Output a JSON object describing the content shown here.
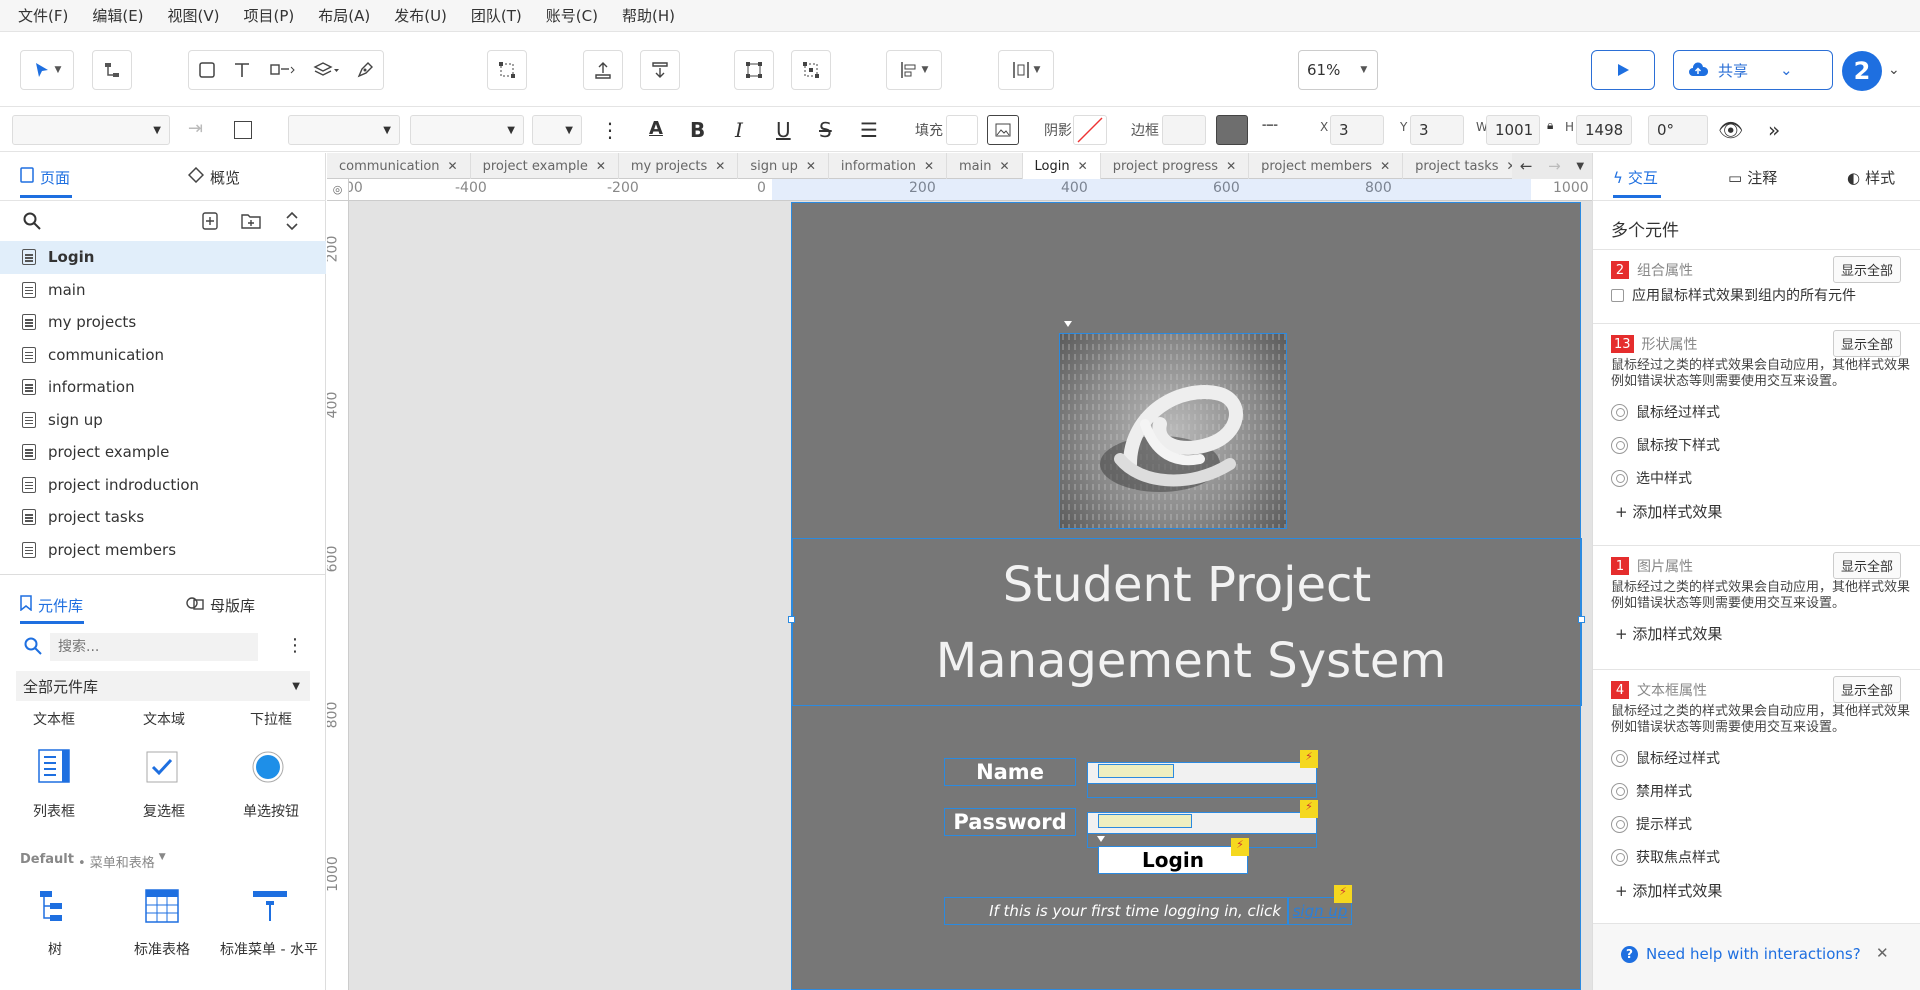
{
  "menubar": [
    "文件(F)",
    "编辑(E)",
    "视图(V)",
    "项目(P)",
    "布局(A)",
    "发布(U)",
    "团队(T)",
    "账号(C)",
    "帮助(H)"
  ],
  "toolbar": {
    "zoom": "61%",
    "share_label": "共享",
    "avatar_count": "2"
  },
  "format": {
    "fill_label": "填充",
    "shadow_label": "阴影",
    "border_label": "边框",
    "x_label": "X",
    "x": "3",
    "y_label": "Y",
    "y": "3",
    "w_label": "W",
    "w": "1001",
    "h_label": "H",
    "h": "1498",
    "rotation": "0°"
  },
  "left": {
    "pages_tab": "页面",
    "overview_tab": "概览",
    "pages": [
      "Login",
      "main",
      "my projects",
      "communication",
      "information",
      "sign up",
      "project example",
      "project indroduction",
      "project tasks",
      "project members"
    ],
    "library_tab": "元件库",
    "masters_tab": "母版库",
    "search_placeholder": "搜索...",
    "library_select": "全部元件库",
    "widgets_top": [
      "文本框",
      "文本域",
      "下拉框"
    ],
    "widgets_mid": [
      "列表框",
      "复选框",
      "单选按钮"
    ],
    "default_label": "Default",
    "default_sub": "• 菜单和表格",
    "widgets_bottom": [
      "树",
      "标准表格",
      "标准菜单 - 水平"
    ]
  },
  "tabs": [
    "communication",
    "project example",
    "my projects",
    "sign up",
    "information",
    "main",
    "Login",
    "project progress",
    "project members",
    "project tasks"
  ],
  "ruler": {
    "h": [
      "00",
      "-400",
      "-200",
      "0",
      "200",
      "400",
      "600",
      "800",
      "1000"
    ],
    "v": [
      "200",
      "400",
      "600",
      "800",
      "1000"
    ]
  },
  "mock": {
    "title_line1": "Student Project",
    "title_line2": "Management System",
    "name_label": "Name",
    "password_label": "Password",
    "login_button": "Login",
    "signup_hint": "If this is your first time logging in, click",
    "signup_link": "sign up"
  },
  "right": {
    "interact_tab": "交互",
    "notes_tab": "注释",
    "style_tab": "样式",
    "heading": "多个元件",
    "show_all": "显示全部",
    "group": {
      "badge": "2",
      "title": "组合属性",
      "checkbox": "应用鼠标样式效果到组内的所有元件"
    },
    "shape": {
      "badge": "13",
      "title": "形状属性",
      "desc": "鼠标经过之类的样式效果会自动应用，其他样式效果例如错误状态等则需要使用交互来设置。",
      "opts": [
        "鼠标经过样式",
        "鼠标按下样式",
        "选中样式"
      ]
    },
    "image": {
      "badge": "1",
      "title": "图片属性",
      "desc": "鼠标经过之类的样式效果会自动应用，其他样式效果例如错误状态等则需要使用交互来设置。"
    },
    "textbox": {
      "badge": "4",
      "title": "文本框属性",
      "desc": "鼠标经过之类的样式效果会自动应用，其他样式效果例如错误状态等则需要使用交互来设置。",
      "opts": [
        "鼠标经过样式",
        "禁用样式",
        "提示样式",
        "获取焦点样式"
      ]
    },
    "add_effect": "+ 添加样式效果",
    "help": "Need help with interactions?"
  }
}
